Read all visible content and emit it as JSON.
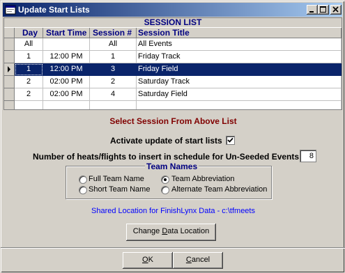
{
  "window": {
    "title": "Update Start Lists"
  },
  "grid": {
    "caption": "SESSION LIST",
    "columns": [
      "Day",
      "Start Time",
      "Session #",
      "Session Title"
    ],
    "rows": [
      [
        "All",
        "",
        "All",
        "All Events"
      ],
      [
        "1",
        "12:00 PM",
        "1",
        "Friday Track"
      ],
      [
        "1",
        "12:00 PM",
        "3",
        "Friday Field"
      ],
      [
        "2",
        "02:00 PM",
        "2",
        "Saturday Track"
      ],
      [
        "2",
        "02:00 PM",
        "4",
        "Saturday Field"
      ],
      [
        "",
        "",
        "",
        ""
      ]
    ],
    "selected_row": 2
  },
  "prompt": "Select Session From Above List",
  "activate": {
    "label": "Activate update of start lists",
    "checked": true
  },
  "heats": {
    "label": "Number of heats/flights to insert in schedule for Un-Seeded Events :",
    "value": "8"
  },
  "team_names": {
    "title": "Team Names",
    "options": [
      "Full Team Name",
      "Team Abbreviation",
      "Short Team Name",
      "Alternate Team Abbreviation"
    ],
    "selected": "Team Abbreviation"
  },
  "shared_location": "Shared Location for FinishLynx Data  -  c:\\tfmeets",
  "buttons": {
    "change_location": {
      "pre": "Change ",
      "key": "D",
      "post": "ata Location"
    },
    "ok": {
      "pre": "",
      "key": "O",
      "post": "K"
    },
    "cancel": {
      "pre": "",
      "key": "C",
      "post": "ancel"
    }
  },
  "colors": {
    "titlebar_start": "#0a246a",
    "titlebar_end": "#a6caf0",
    "selection": "#0a246a",
    "prompt": "#800000",
    "link_blue": "#0000ff",
    "header_blue": "#000080"
  }
}
